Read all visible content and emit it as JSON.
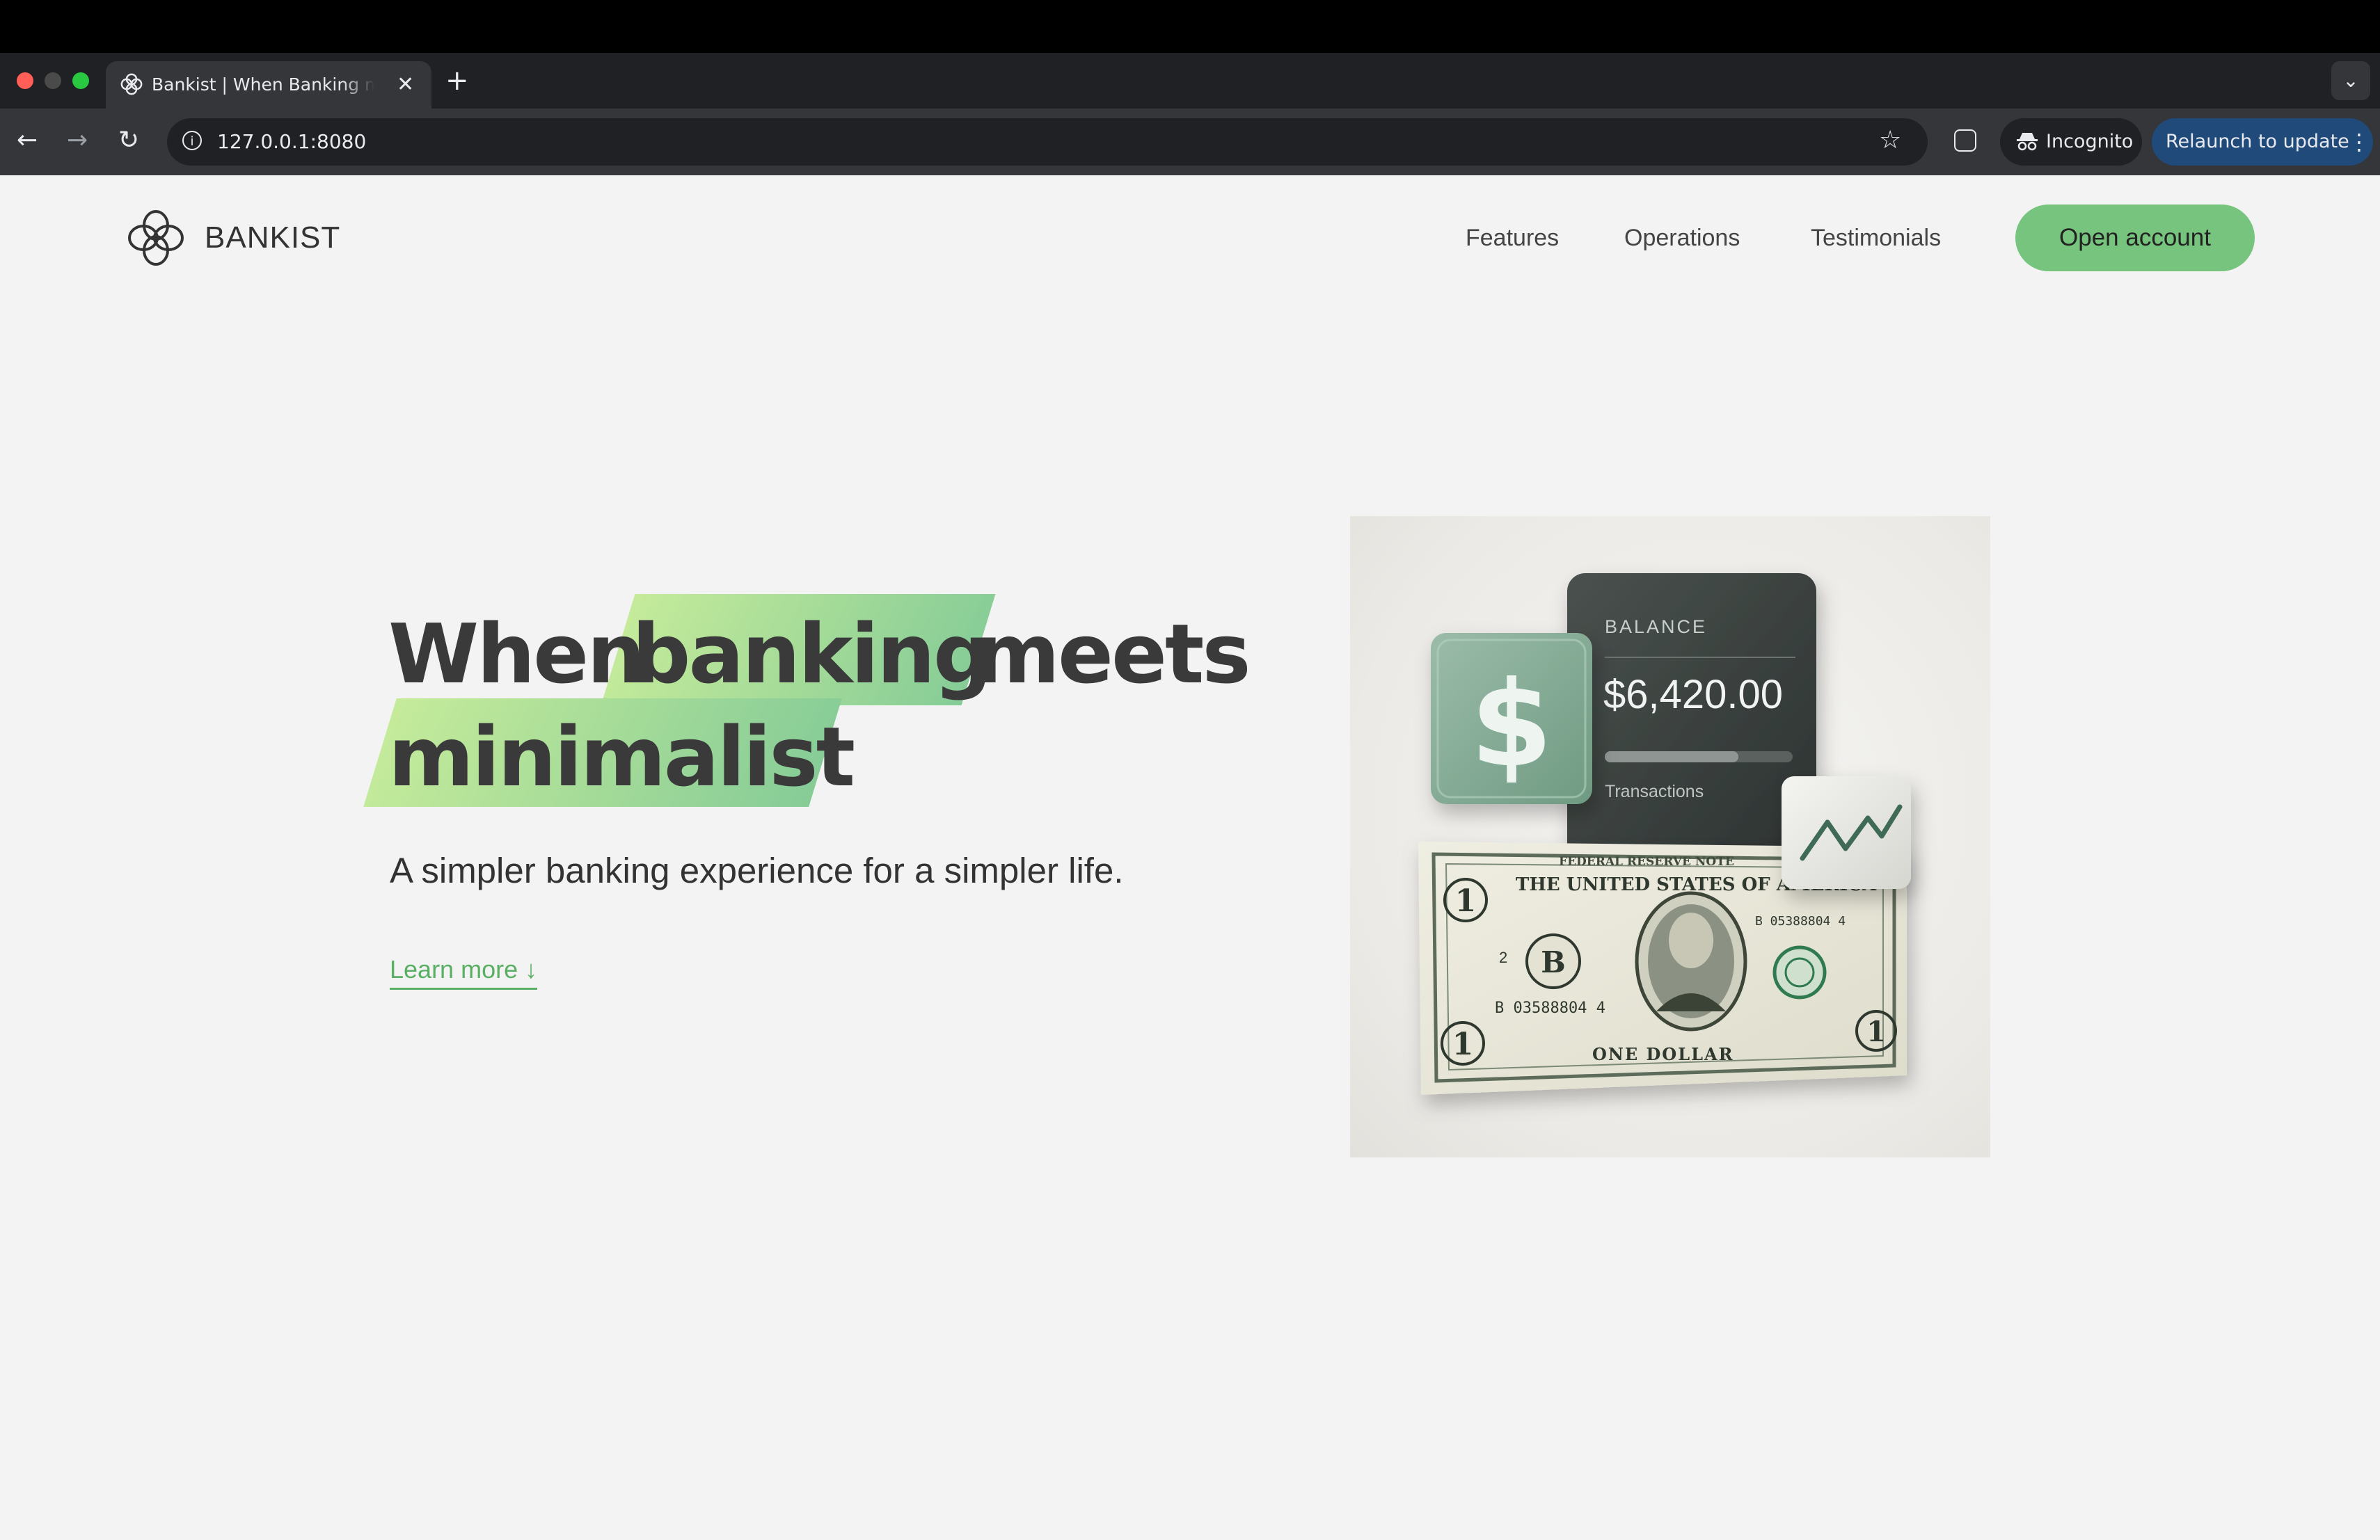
{
  "browser": {
    "tab_title": "Bankist | When Banking meets minimalist",
    "url": "127.0.0.1:8080",
    "incognito_label": "Incognito",
    "relaunch_label": "Relaunch to update",
    "new_tab": "+",
    "tab_close": "✕",
    "back": "←",
    "forward": "→",
    "reload": "↻",
    "star": "☆",
    "menu_dots": "⋮",
    "tab_list": "⌄",
    "info": "i"
  },
  "nav": {
    "brand": "BANKIST",
    "links": [
      "Features",
      "Operations",
      "Testimonials"
    ],
    "cta": "Open account"
  },
  "hero": {
    "title_part1": "When",
    "title_highlight1": "banking",
    "title_part2": "meets",
    "title_highlight2": "minimalist",
    "subtitle": "A simpler banking experience for a simpler life.",
    "learn_more": "Learn more ↓"
  },
  "illustration": {
    "card_label": "BALANCE",
    "card_amount": "$6,420.00",
    "card_footer": "Transactions",
    "dollar_symbol": "$",
    "bill_top": "FEDERAL RESERVE NOTE",
    "bill_heading": "THE UNITED STATES OF AMERICA",
    "bill_serial": "B 03588804 4",
    "bill_serial_right": "B 05388804 4",
    "bill_bottom": "ONE DOLLAR",
    "bill_corner": "1",
    "bill_seal_letter": "B",
    "bill_small_2": "2"
  },
  "colors": {
    "brand_green": "#76c47d",
    "highlight_start": "#c5eb9a",
    "highlight_end": "#86cc97",
    "link_green": "#5aaf64",
    "page_bg": "#f3f3f3"
  }
}
